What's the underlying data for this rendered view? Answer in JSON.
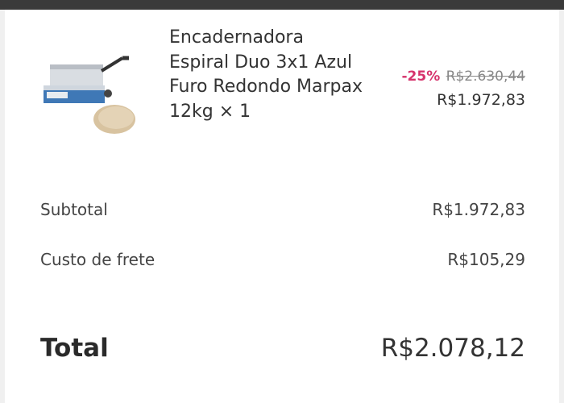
{
  "cart_item": {
    "name": "Encadernadora Espiral Duo 3x1 Azul Furo Redondo Marpax 12kg × 1",
    "discount_badge": "-25%",
    "original_price": "R$2.630,44",
    "price": "R$1.972,83",
    "thumb_icon": "binding-machine-icon"
  },
  "summary": {
    "subtotal_label": "Subtotal",
    "subtotal_value": "R$1.972,83",
    "shipping_label": "Custo de frete",
    "shipping_value": "R$105,29",
    "total_label": "Total",
    "total_value": "R$2.078,12"
  },
  "colors": {
    "discount": "#d6336c",
    "machine_blue": "#3f78b6",
    "top_bar": "#3a3a3a"
  }
}
